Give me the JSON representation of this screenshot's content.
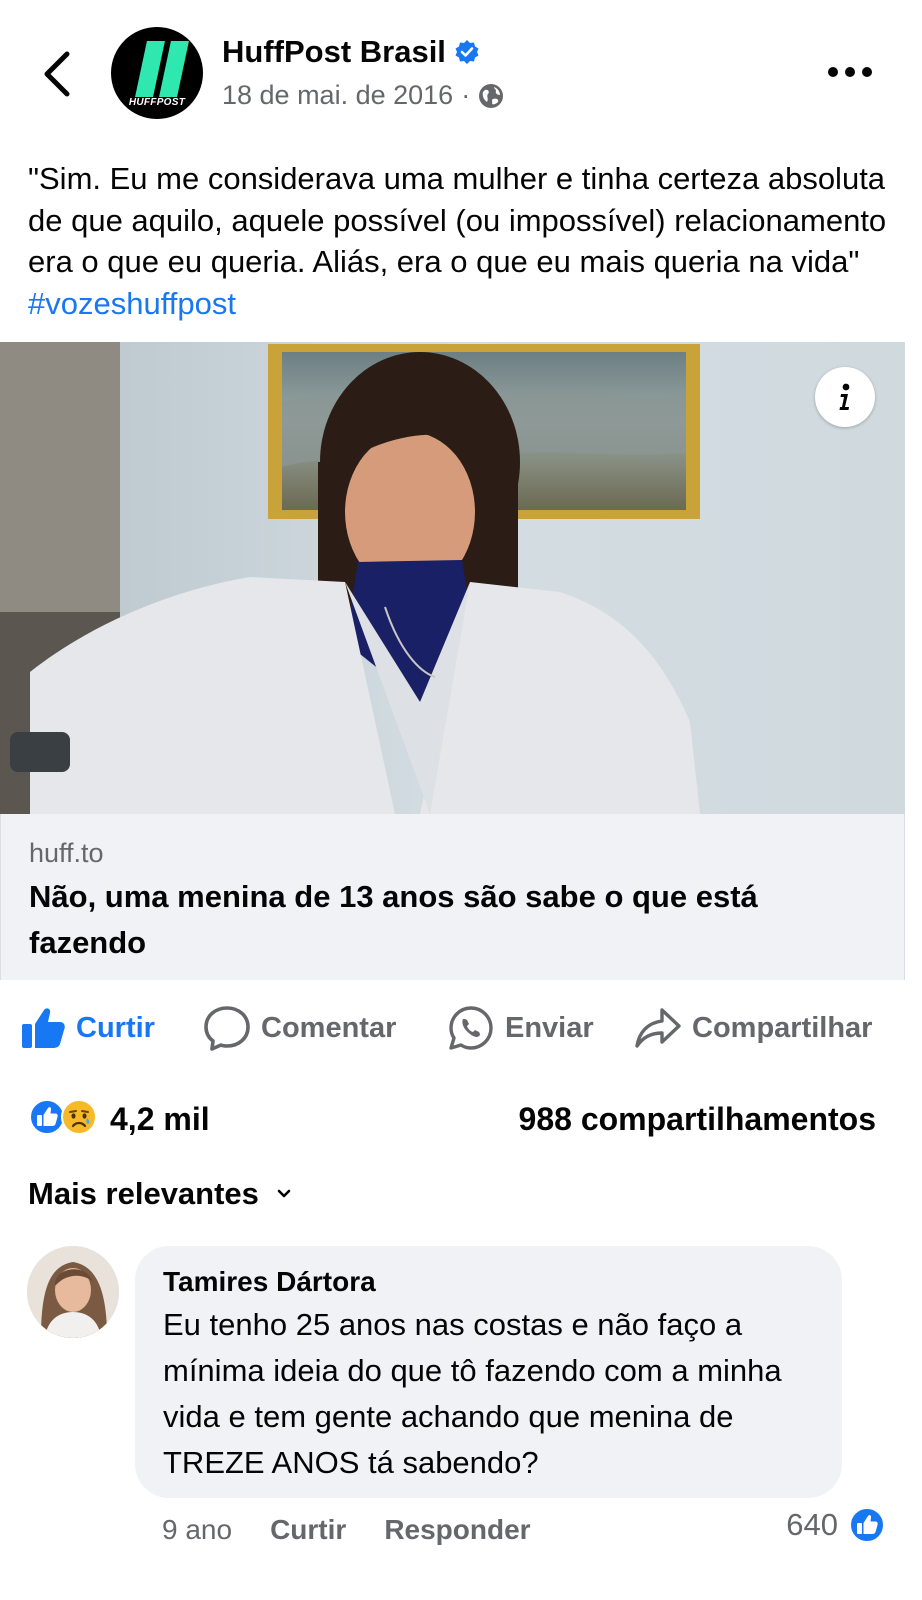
{
  "header": {
    "page_name": "HuffPost Brasil",
    "avatar_text": "HUFFPOST",
    "date": "18 de mai. de 2016",
    "separator": "·"
  },
  "post": {
    "caption_text": "\"Sim. Eu me considerava uma mulher e tinha certeza absoluta de que aquilo, aquele possível (ou impossível) relacionamento era o que eu queria. Aliás, era o que eu mais queria na vida\"",
    "hashtag": "#vozeshuffpost"
  },
  "link": {
    "domain": "huff.to",
    "title": "Não, uma menina de 13 anos são sabe o que está fazendo"
  },
  "actions": {
    "like": "Curtir",
    "comment": "Comentar",
    "send": "Enviar",
    "share": "Compartilhar"
  },
  "stats": {
    "reactions_count": "4,2 mil",
    "shares": "988 compartilhamentos"
  },
  "comments": {
    "sort_label": "Mais relevantes",
    "items": [
      {
        "author": "Tamires Dártora",
        "text": "Eu tenho 25 anos nas costas e não faço a mínima ideia do que tô fazendo com a minha vida e tem gente achando que menina de TREZE ANOS tá sabendo?",
        "time": "9 ano",
        "like_label": "Curtir",
        "reply_label": "Responder",
        "likes": "640"
      }
    ]
  },
  "colors": {
    "accent": "#1877f2",
    "secondary_text": "#65676b",
    "bubble": "#f0f2f5",
    "huffpost_green": "#2ee8b0"
  },
  "icons": [
    "back-arrow-icon",
    "verified-badge-icon",
    "globe-icon",
    "more-options-icon",
    "info-icon",
    "like-thumb-icon",
    "comment-icon",
    "whatsapp-icon",
    "share-arrow-icon",
    "like-reaction-icon",
    "sad-reaction-icon",
    "chevron-down-icon"
  ]
}
